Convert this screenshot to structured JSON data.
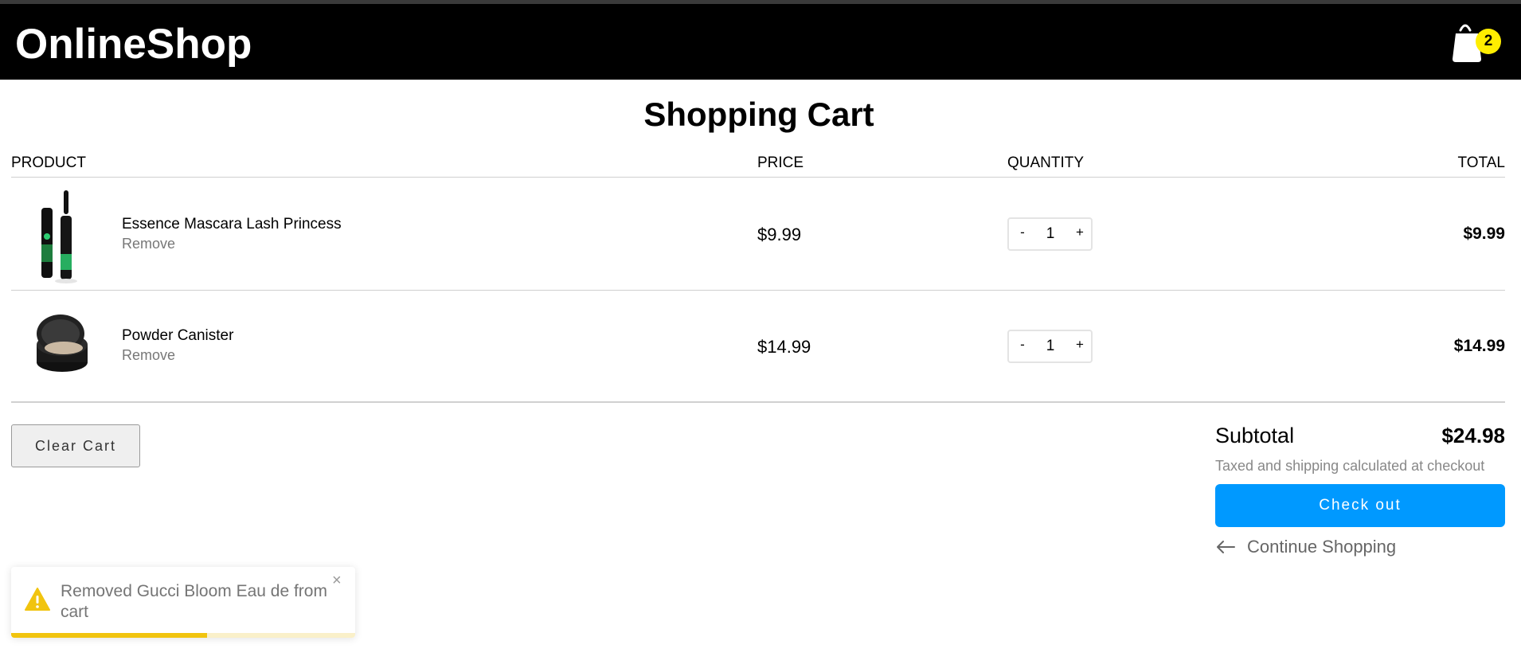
{
  "app": {
    "brand": "OnlineShop",
    "cart_count": "2"
  },
  "page": {
    "title": "Shopping Cart"
  },
  "table": {
    "headers": {
      "product": "PRODUCT",
      "price": "PRICE",
      "quantity": "QUANTITY",
      "total": "TOTAL"
    },
    "rows": [
      {
        "name": "Essence Mascara Lash Princess",
        "remove_label": "Remove",
        "price": "$9.99",
        "quantity": "1",
        "total": "$9.99",
        "image_icon": "mascara-product-image"
      },
      {
        "name": "Powder Canister",
        "remove_label": "Remove",
        "price": "$14.99",
        "quantity": "1",
        "total": "$14.99",
        "image_icon": "powder-canister-product-image"
      }
    ],
    "qty_minus": "-",
    "qty_plus": "+"
  },
  "actions": {
    "clear_cart": "Clear Cart"
  },
  "summary": {
    "subtotal_label": "Subtotal",
    "subtotal_value": "$24.98",
    "tax_note": "Taxed and shipping calculated at checkout",
    "checkout_label": "Check out",
    "continue_label": "Continue Shopping"
  },
  "toast": {
    "message": "Removed Gucci Bloom Eau de from cart",
    "close_symbol": "×",
    "icon": "warning-icon",
    "progress_fraction": 0.57
  },
  "colors": {
    "navbar": "#000000",
    "badge": "#ffee00",
    "checkout": "#0099ff",
    "toast_progress": "#f1c40f"
  }
}
